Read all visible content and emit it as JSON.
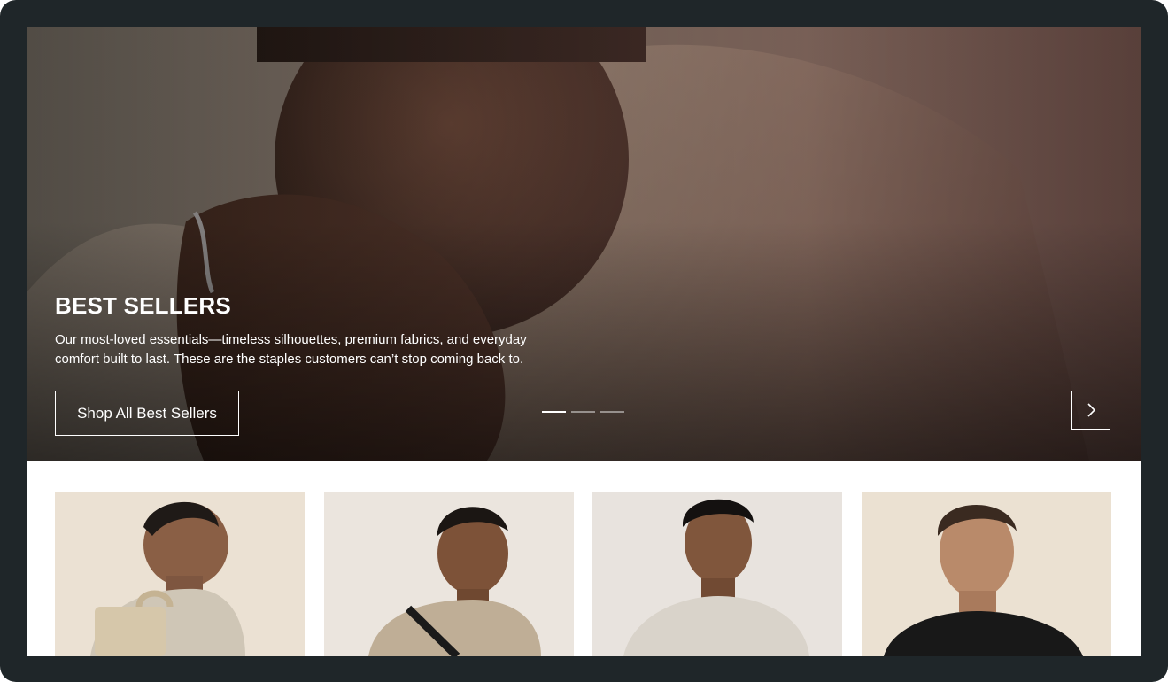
{
  "hero": {
    "title": "BEST SELLERS",
    "description": "Our most-loved essentials—timeless silhouettes, premium fabrics, and everyday comfort built to last. These are the staples customers can’t stop coming back to.",
    "cta_label": "Shop All Best Sellers",
    "slides_total": 3,
    "active_slide": 1,
    "next_icon": "chevron-right-icon"
  },
  "products": [
    {
      "image": "model-side-profile-backpack",
      "background": "#ebe1d3"
    },
    {
      "image": "model-beige-tee-bag-strap",
      "background": "#ebe5de"
    },
    {
      "image": "model-grey-sweater",
      "background": "#e8e3de"
    },
    {
      "image": "model-black-tee",
      "background": "#ebe1d2"
    }
  ],
  "colors": {
    "frame": "#1f2629",
    "accent_text": "#ffffff"
  }
}
